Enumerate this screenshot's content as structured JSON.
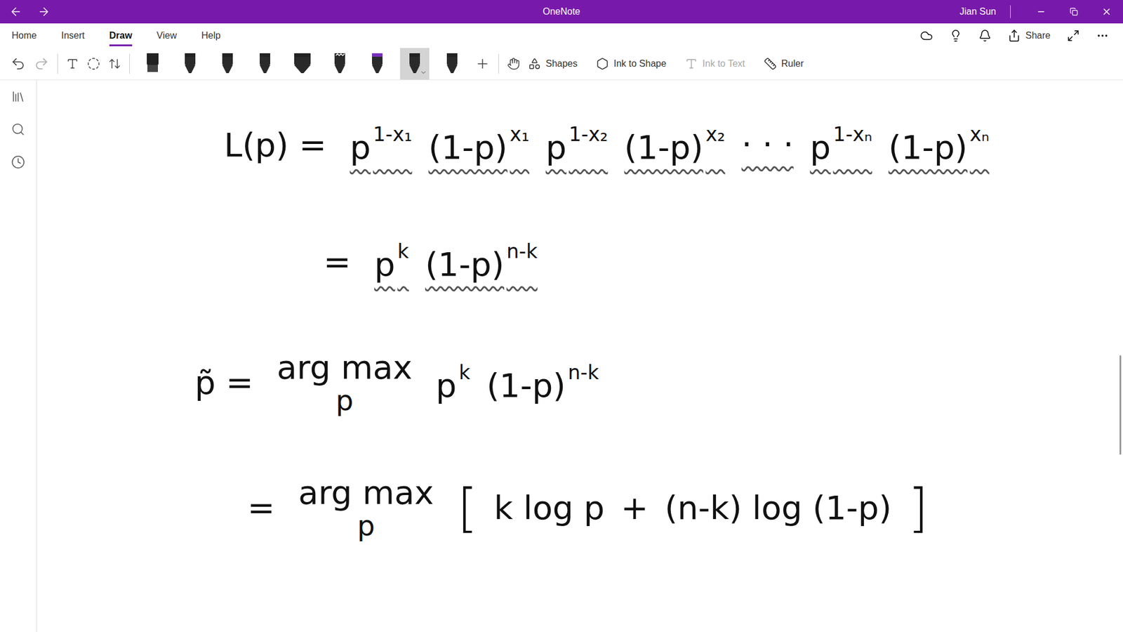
{
  "window": {
    "title": "OneNote",
    "user": "Jian Sun"
  },
  "menu": [
    {
      "label": "Home",
      "selected": false
    },
    {
      "label": "Insert",
      "selected": false
    },
    {
      "label": "Draw",
      "selected": true
    },
    {
      "label": "View",
      "selected": false
    },
    {
      "label": "Help",
      "selected": false
    }
  ],
  "share": "Share",
  "pens": [
    {
      "kind": "marker",
      "color": "#222222",
      "selected": false
    },
    {
      "kind": "pen",
      "color": "#222222",
      "selected": false
    },
    {
      "kind": "pen",
      "color": "#222222",
      "selected": false
    },
    {
      "kind": "pen",
      "color": "#222222",
      "selected": false
    },
    {
      "kind": "highlighter",
      "color": "#222222",
      "selected": false
    },
    {
      "kind": "galaxy",
      "color": "#222222",
      "selected": false
    },
    {
      "kind": "pen",
      "color": "#7b2fbe",
      "selected": false
    },
    {
      "kind": "pen",
      "color": "#222222",
      "selected": true
    },
    {
      "kind": "pen",
      "color": "#222222",
      "selected": false
    }
  ],
  "actions": [
    {
      "label": "Shapes",
      "disabled": false
    },
    {
      "label": "Ink to Shape",
      "disabled": false
    },
    {
      "label": "Ink to Text",
      "disabled": true
    },
    {
      "label": "Ruler",
      "disabled": false
    }
  ],
  "equations": [
    {
      "lhs": "L(p) =",
      "underlined": true,
      "terms": [
        {
          "kind": "power",
          "base": "p",
          "sup": "1-x₁"
        },
        {
          "kind": "power",
          "base": "(1-p)",
          "sup": "x₁"
        },
        {
          "kind": "power",
          "base": "p",
          "sup": "1-x₂"
        },
        {
          "kind": "power",
          "base": "(1-p)",
          "sup": "x₂"
        },
        {
          "kind": "plain",
          "base": "· · ·"
        },
        {
          "kind": "power",
          "base": "p",
          "sup": "1-xₙ"
        },
        {
          "kind": "power",
          "base": "(1-p)",
          "sup": "xₙ"
        }
      ]
    },
    {
      "lhs": "=",
      "underlined": true,
      "terms": [
        {
          "kind": "power",
          "base": "p",
          "sup": "k"
        },
        {
          "kind": "power",
          "base": "(1-p)",
          "sup": "n-k"
        }
      ]
    },
    {
      "lhs": "p̃ =",
      "operator": {
        "text": "arg max",
        "below": "p"
      },
      "underlined": false,
      "terms": [
        {
          "kind": "power",
          "base": "p",
          "sup": "k"
        },
        {
          "kind": "power",
          "base": "(1-p)",
          "sup": "n-k"
        }
      ]
    },
    {
      "lhs": "=",
      "operator": {
        "text": "arg max",
        "below": "p"
      },
      "underlined": false,
      "terms": [
        {
          "kind": "bracket",
          "base": "["
        },
        {
          "kind": "plain",
          "base": "k log p"
        },
        {
          "kind": "plain",
          "base": "+"
        },
        {
          "kind": "plain",
          "base": "(n-k) log (1-p)"
        },
        {
          "kind": "bracket",
          "base": "]"
        }
      ]
    }
  ]
}
